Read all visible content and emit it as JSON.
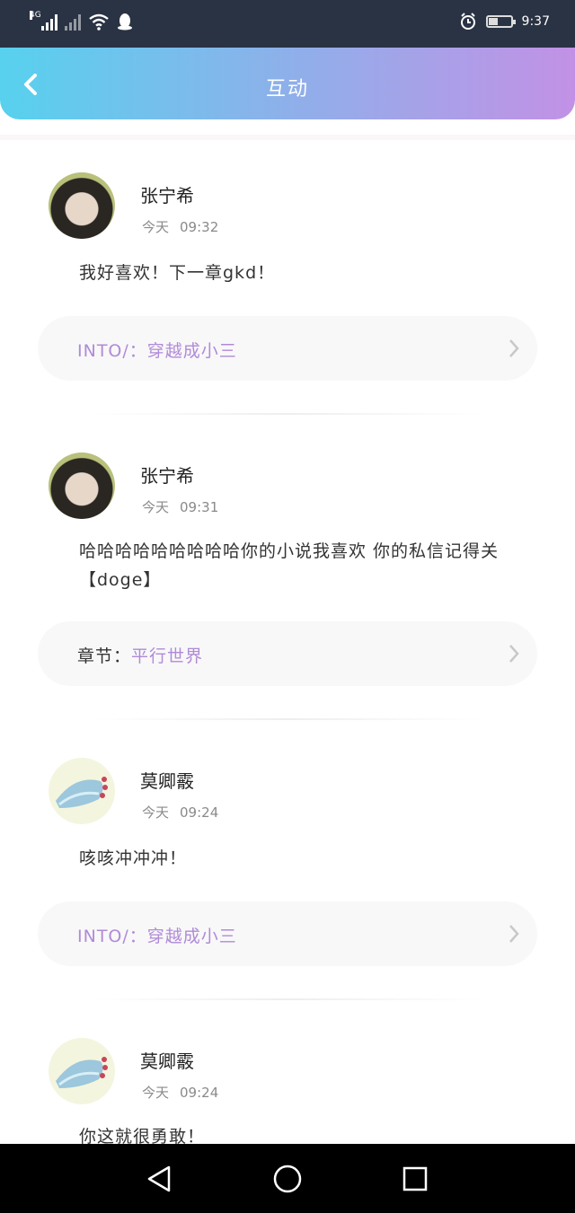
{
  "status_bar": {
    "network_label": "4G",
    "time": "9:37",
    "battery_level": 0.45
  },
  "header": {
    "title": "互动"
  },
  "posts": [
    {
      "username": "张宁希",
      "date": "今天",
      "time": "09:32",
      "message": "我好喜欢！下一章gkd！",
      "link_label": "INTO/：",
      "link_value": "穿越成小三"
    },
    {
      "username": "张宁希",
      "date": "今天",
      "time": "09:31",
      "message": "哈哈哈哈哈哈哈哈哈你的小说我喜欢 你的私信记得关【doge】",
      "link_label": "章节：",
      "link_value": "平行世界"
    },
    {
      "username": "莫卿霰",
      "date": "今天",
      "time": "09:24",
      "message": "咳咳冲冲冲！",
      "link_label": "INTO/：",
      "link_value": "穿越成小三"
    },
    {
      "username": "莫卿霰",
      "date": "今天",
      "time": "09:24",
      "message": "你这就很勇敢！"
    }
  ],
  "colors": {
    "header_gradient_start": "#57d1ee",
    "header_gradient_end": "#c291e6",
    "link_accent": "#b08ad8"
  }
}
